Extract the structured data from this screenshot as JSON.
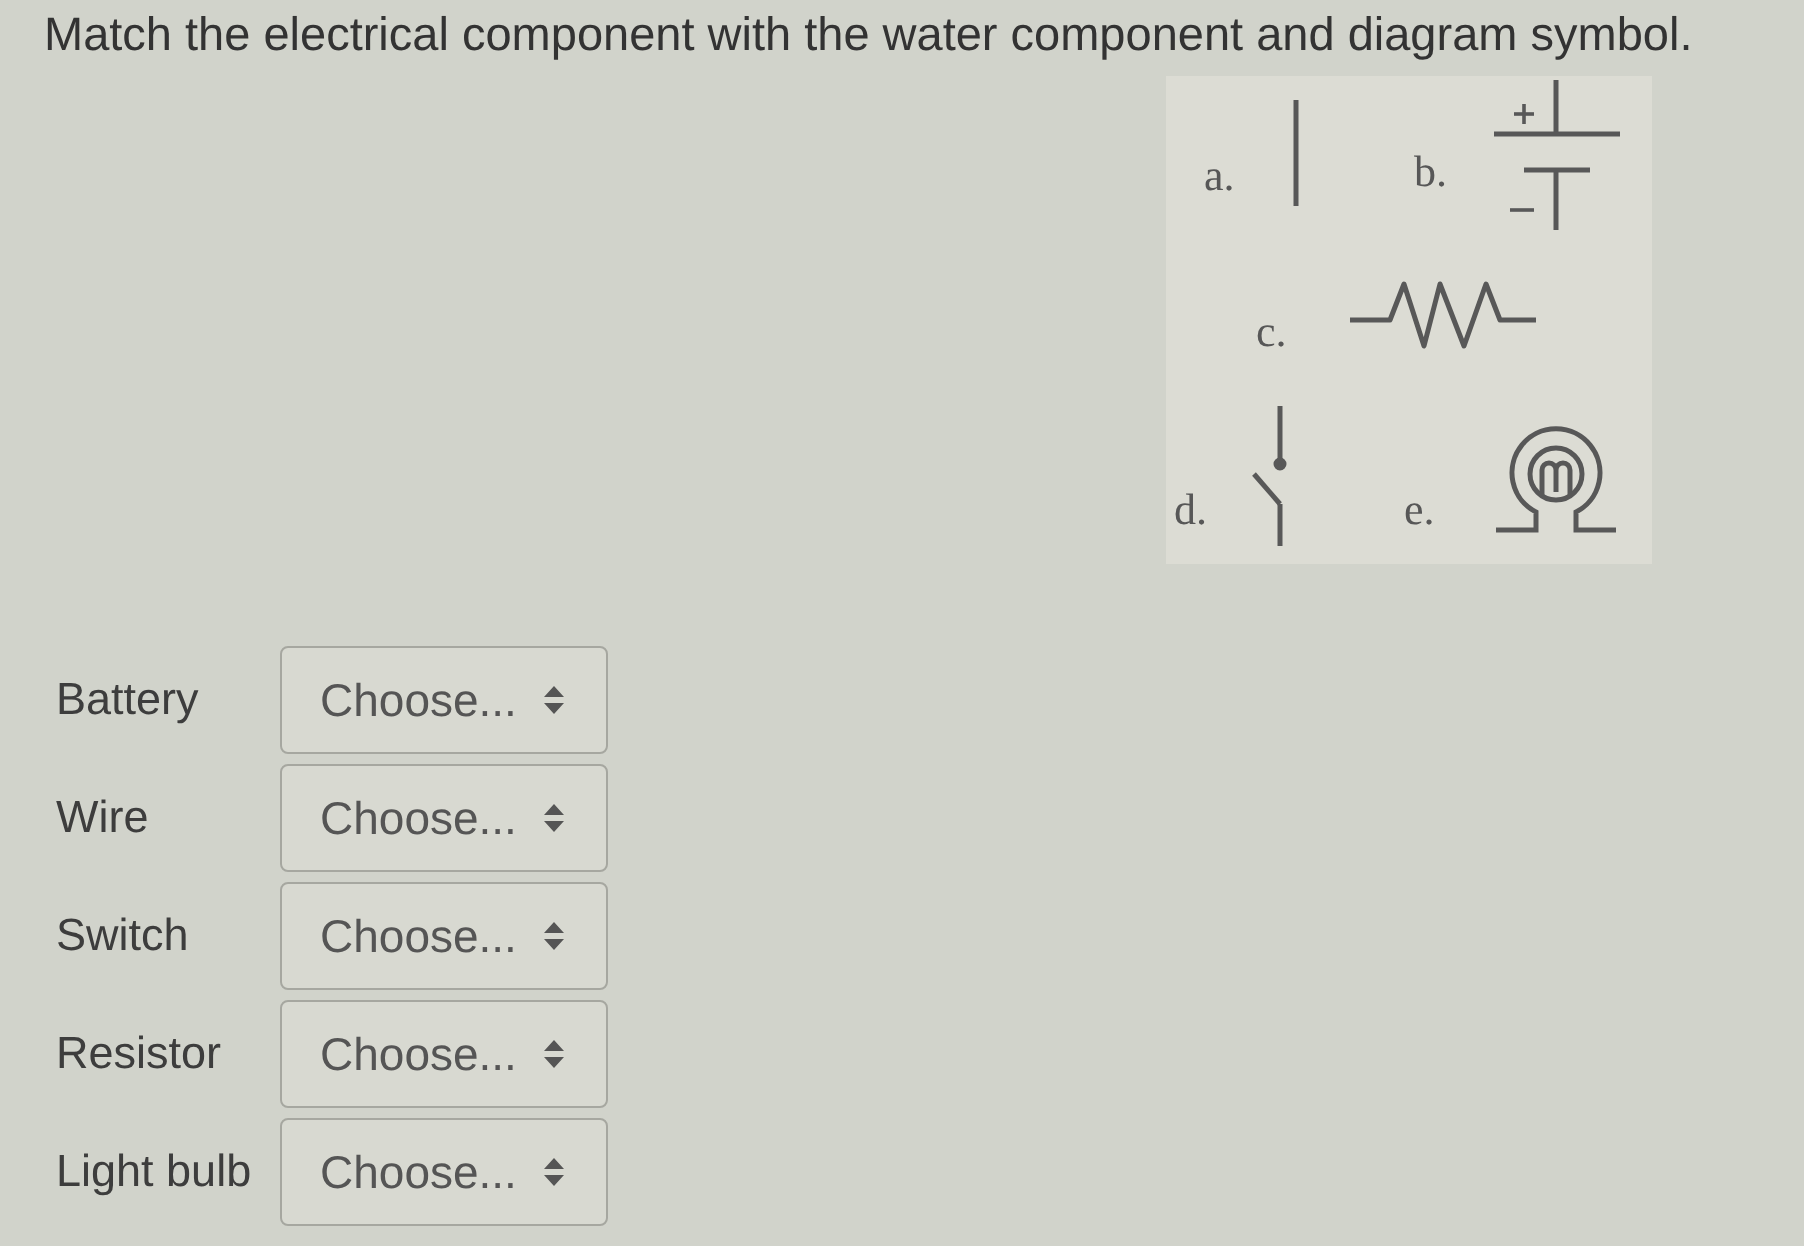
{
  "instruction": "Match the electrical component with the water component and diagram symbol.",
  "figure": {
    "symbols": [
      {
        "letter": "a.",
        "kind": "wire"
      },
      {
        "letter": "b.",
        "kind": "battery"
      },
      {
        "letter": "c.",
        "kind": "resistor"
      },
      {
        "letter": "d.",
        "kind": "switch"
      },
      {
        "letter": "e.",
        "kind": "lamp"
      }
    ]
  },
  "matches": [
    {
      "label": "Battery",
      "value": "Choose..."
    },
    {
      "label": "Wire",
      "value": "Choose..."
    },
    {
      "label": "Switch",
      "value": "Choose..."
    },
    {
      "label": "Resistor",
      "value": "Choose..."
    },
    {
      "label": "Light bulb",
      "value": "Choose..."
    }
  ]
}
